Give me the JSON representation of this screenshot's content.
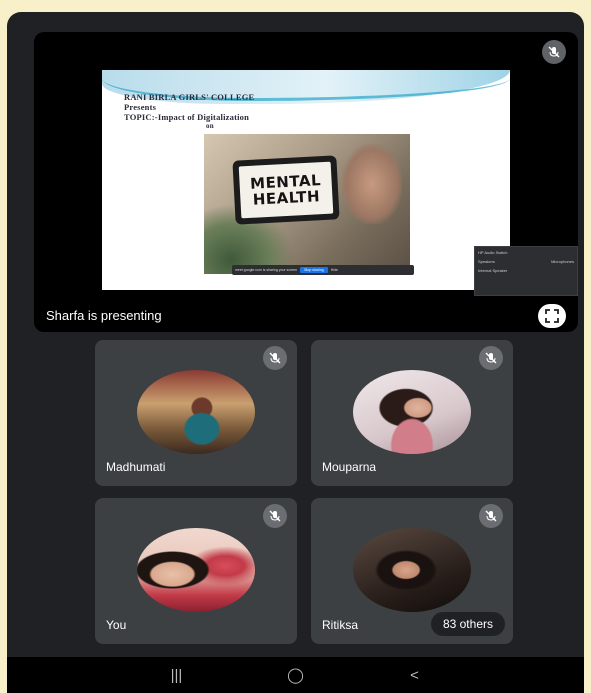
{
  "presentation": {
    "presenter_caption": "Sharfa is presenting",
    "slide": {
      "line1": "RANI BIRLA GIRLS' COLLEGE",
      "line2": "Presents",
      "line3": "TOPIC:-Impact of Digitalization",
      "line4": "on",
      "image_text_1": "MENTAL",
      "image_text_2": "HEALTH"
    },
    "share_bar": {
      "message": "meet.google.com is sharing your screen",
      "stop_label": "Stop sharing",
      "hide_label": "Hide"
    },
    "audio_popup": {
      "title": "HP Audio Switch",
      "col1": "Speakers",
      "col2": "Microphones",
      "item": "Internal Speaker"
    }
  },
  "participants": [
    {
      "name": "Madhumati"
    },
    {
      "name": "Mouparna"
    },
    {
      "name": "You"
    },
    {
      "name": "Ritiksa"
    }
  ],
  "others_badge": "83 others",
  "navbar": {
    "recents": "|||",
    "home": "◯",
    "back": "<"
  },
  "colors": {
    "background": "#f7f0c8",
    "device": "#202124",
    "tile": "#3c4043",
    "share_button": "#1a73e8"
  },
  "icons": [
    "mic-off-icon",
    "fullscreen-icon",
    "recents-icon",
    "home-icon",
    "back-icon"
  ]
}
